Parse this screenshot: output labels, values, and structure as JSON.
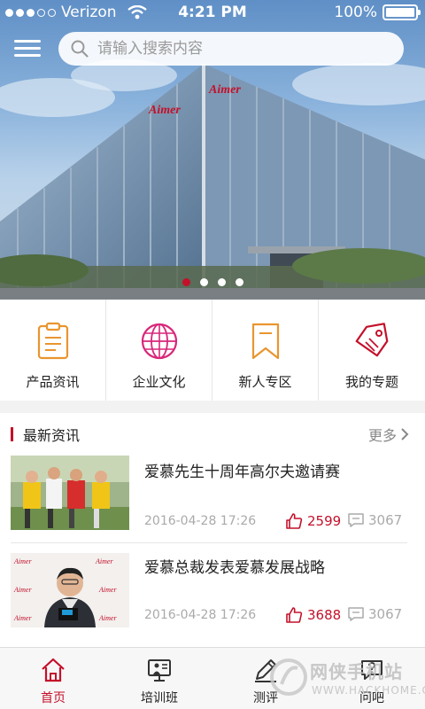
{
  "status_bar": {
    "carrier": "Verizon",
    "time": "4:21 PM",
    "battery": "100%"
  },
  "search": {
    "placeholder": "请输入搜索内容"
  },
  "banner": {
    "building_signs": [
      "Aimer",
      "Aimer"
    ],
    "slides": 4,
    "active_slide": 1
  },
  "categories": [
    {
      "label": "产品资讯",
      "icon": "clipboard-icon"
    },
    {
      "label": "企业文化",
      "icon": "globe-icon"
    },
    {
      "label": "新人专区",
      "icon": "bookmark-icon"
    },
    {
      "label": "我的专题",
      "icon": "tag-icon"
    }
  ],
  "news": {
    "heading": "最新资讯",
    "more": "更多",
    "items": [
      {
        "title": "爱慕先生十周年高尔夫邀请赛",
        "date": "2016-04-28 17:26",
        "likes": "2599",
        "comments": "3067"
      },
      {
        "title": "爱慕总裁发表爱慕发展战略",
        "date": "2016-04-28 17:26",
        "likes": "3688",
        "comments": "3067"
      }
    ]
  },
  "tabs": [
    {
      "label": "首页",
      "icon": "home-icon",
      "active": true
    },
    {
      "label": "培训班",
      "icon": "presentation-icon",
      "active": false
    },
    {
      "label": "测评",
      "icon": "pen-icon",
      "active": false
    },
    {
      "label": "问吧",
      "icon": "question-bubble-icon",
      "active": false
    }
  ],
  "watermark": {
    "text": "网侠手机站",
    "url": "WWW.HACKHOME.COM"
  },
  "colors": {
    "accent": "#c4102a",
    "icon_orange": "#e9952f",
    "icon_pink": "#d8277a"
  }
}
